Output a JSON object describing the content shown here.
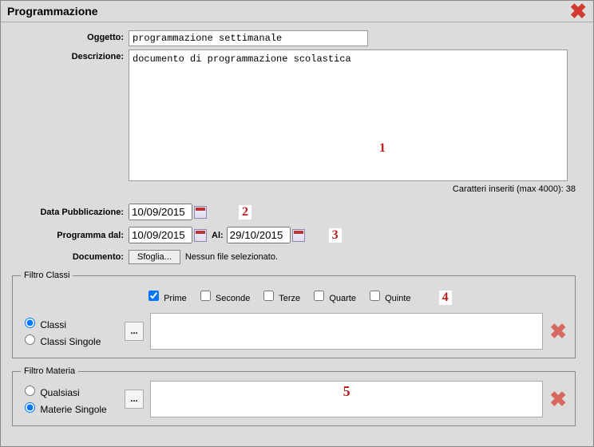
{
  "window": {
    "title": "Programmazione"
  },
  "labels": {
    "oggetto": "Oggetto:",
    "descrizione": "Descrizione:",
    "data_pubblicazione": "Data Pubblicazione:",
    "programma_dal": "Programma dal:",
    "al": "Al:",
    "documento": "Documento:",
    "sfoglia": "Sfoglia...",
    "nessun_file": "Nessun file selezionato.",
    "char_count_prefix": "Caratteri inseriti (max 4000): ",
    "char_count_value": "38"
  },
  "values": {
    "oggetto": "programmazione settimanale",
    "descrizione": "documento di programmazione scolastica",
    "data_pubblicazione": "10/09/2015",
    "programma_dal": "10/09/2015",
    "programma_al": "29/10/2015"
  },
  "markers": {
    "m1": "1",
    "m2": "2",
    "m3": "3",
    "m4": "4",
    "m5": "5"
  },
  "filtro_classi": {
    "legend": "Filtro Classi",
    "checkboxes": {
      "prime": "Prime",
      "seconde": "Seconde",
      "terze": "Terze",
      "quarte": "Quarte",
      "quinte": "Quinte"
    },
    "radio": {
      "classi": "Classi",
      "classi_singole": "Classi Singole"
    }
  },
  "filtro_materia": {
    "legend": "Filtro Materia",
    "radio": {
      "qualsiasi": "Qualsiasi",
      "materie_singole": "Materie Singole"
    }
  },
  "icons": {
    "ellipsis": "..."
  }
}
